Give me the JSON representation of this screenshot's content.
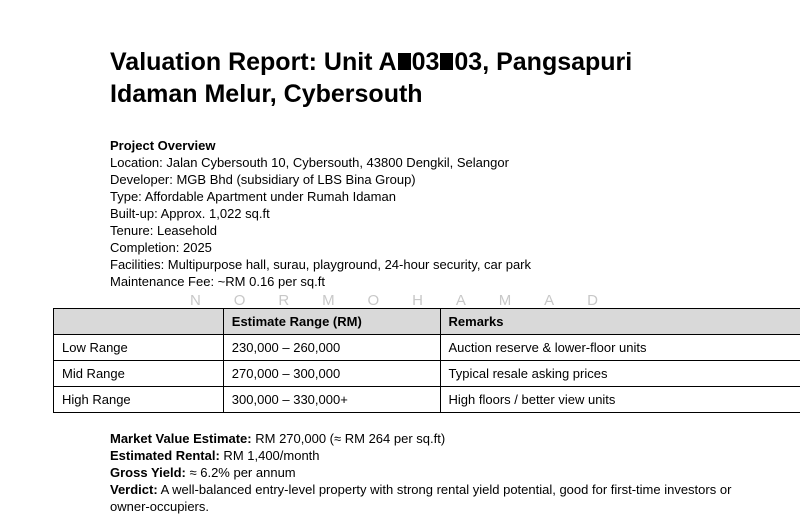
{
  "title": {
    "line1_part1": "Valuation Report: Unit A",
    "line1_part2": "03",
    "line1_part3": "03, Pangsapuri",
    "line2": "Idaman Melur, Cybersouth"
  },
  "overview": {
    "heading": "Project Overview",
    "lines": [
      "Location: Jalan Cybersouth 10, Cybersouth, 43800 Dengkil, Selangor",
      "Developer: MGB Bhd (subsidiary of LBS Bina Group)",
      "Type: Affordable Apartment under Rumah Idaman",
      "Built-up: Approx. 1,022 sq.ft",
      "Tenure: Leasehold",
      "Completion: 2025",
      "Facilities: Multipurpose hall, surau, playground, 24-hour security, car park",
      "Maintenance Fee: ~RM 0.16 per sq.ft"
    ]
  },
  "watermark": [
    "N",
    "O",
    "R",
    "M",
    "O",
    "H",
    "A",
    "M",
    "A",
    "D"
  ],
  "table": {
    "headers": [
      "",
      "Estimate Range (RM)",
      "Remarks"
    ],
    "rows": [
      [
        "Low Range",
        "230,000 – 260,000",
        "Auction reserve & lower-floor units"
      ],
      [
        "Mid Range",
        "270,000 – 300,000",
        "Typical resale asking prices"
      ],
      [
        "High Range",
        "300,000 – 330,000+",
        "High floors / better view units"
      ]
    ]
  },
  "summary": {
    "market_label": "Market Value Estimate:",
    "market_value": " RM 270,000 (≈ RM 264 per sq.ft)",
    "rental_label": "Estimated Rental:",
    "rental_value": " RM 1,400/month",
    "yield_label": "Gross Yield:",
    "yield_value": " ≈ 6.2% per annum",
    "verdict_label": "Verdict:",
    "verdict_value": " A well-balanced entry-level property with strong rental yield potential, good for first-time investors or owner-occupiers."
  }
}
